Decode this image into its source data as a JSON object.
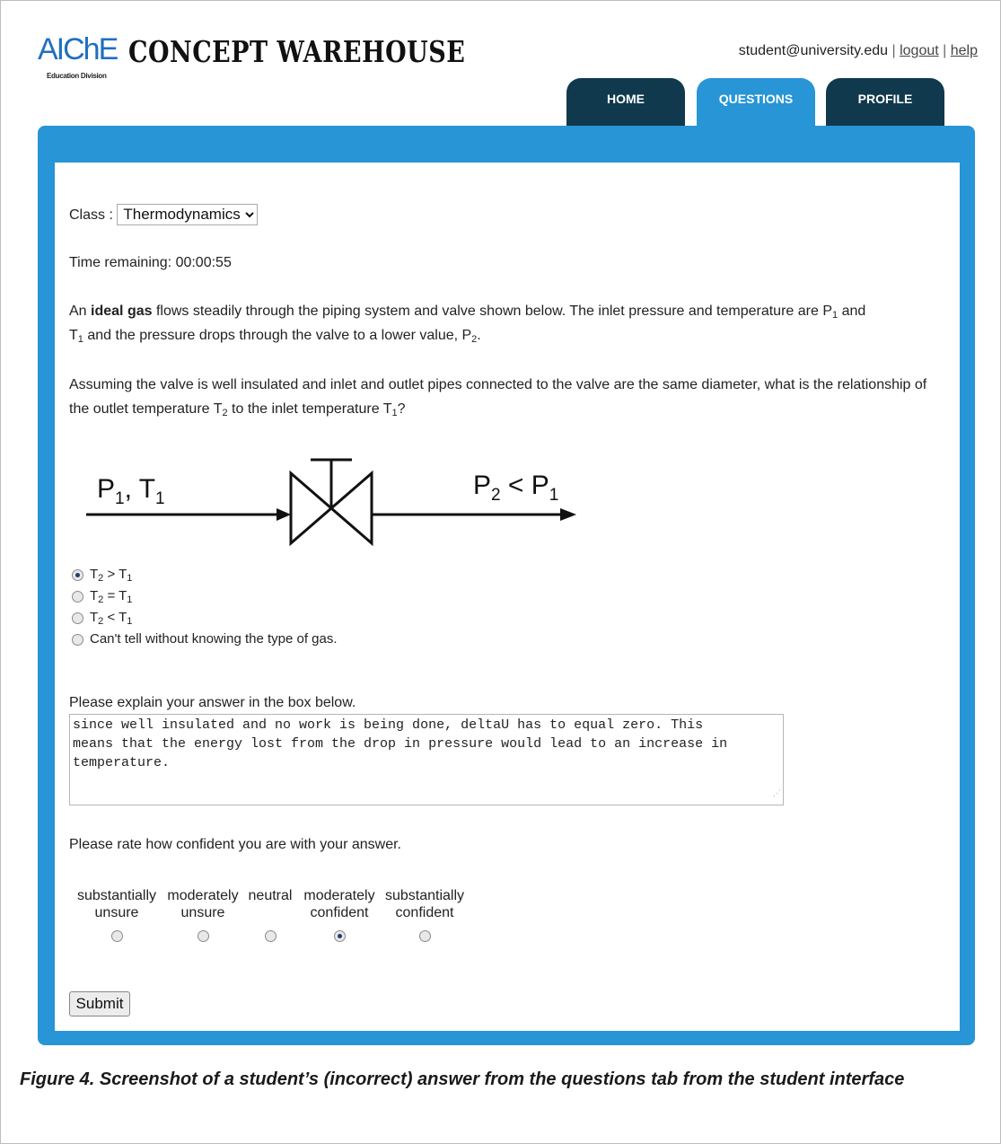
{
  "header": {
    "logo_brand": "AIChE",
    "logo_division": "Education Division",
    "app_title": "CONCEPT WAREHOUSE",
    "user_email": "student@university.edu",
    "separator": "|",
    "logout_label": "logout",
    "help_label": "help"
  },
  "tabs": [
    {
      "label": "HOME",
      "active": false
    },
    {
      "label": "QUESTIONS",
      "active": true
    },
    {
      "label": "PROFILE",
      "active": false
    }
  ],
  "colors": {
    "accent": "#2795d6",
    "tab_dark": "#10394d",
    "brand": "#1f6fc0"
  },
  "main": {
    "class_label": "Class :",
    "class_value": "Thermodynamics",
    "time_label": "Time remaining:",
    "time_value": "00:00:55",
    "question_p1_prefix": "An",
    "question_p1_bold": "ideal gas",
    "question_p1_rest": "flows steadily through the piping system and valve shown below. The inlet pressure and temperature are P",
    "question_p1_and": "and",
    "question_p1_rest2": "and the pressure drops through the valve to a lower value, P",
    "question_p2": "Assuming the valve is well insulated and inlet and outlet pipes connected to the valve are the same diameter, what is the relationship of the outlet temperature T",
    "question_p2_mid": "to the inlet temperature T",
    "diagram": {
      "inlet_label": "P1, T1",
      "outlet_label": "P2 < P1"
    },
    "options": [
      {
        "label": "T2 > T1",
        "selected": true
      },
      {
        "label": "T2 = T1",
        "selected": false
      },
      {
        "label": "T2 < T1",
        "selected": false
      },
      {
        "label": "Can't tell without knowing the type of gas.",
        "selected": false
      }
    ],
    "explain_label": "Please explain your answer in the box below.",
    "explain_answer": "since well insulated and no work is being done, deltaU has to equal zero. This\nmeans that the energy lost from the drop in pressure would lead to an increase in\ntemperature.",
    "confidence_label": "Please rate how confident you are with your answer.",
    "confidence_scale": [
      {
        "line1": "substantially",
        "line2": "unsure",
        "selected": false
      },
      {
        "line1": "moderately",
        "line2": "unsure",
        "selected": false
      },
      {
        "line1": "neutral",
        "line2": "",
        "selected": false
      },
      {
        "line1": "moderately",
        "line2": "confident",
        "selected": true
      },
      {
        "line1": "substantially",
        "line2": "confident",
        "selected": false
      }
    ],
    "submit_label": "Submit"
  },
  "caption": "Figure 4. Screenshot of a student’s (incorrect) answer from the questions tab from the student interface"
}
